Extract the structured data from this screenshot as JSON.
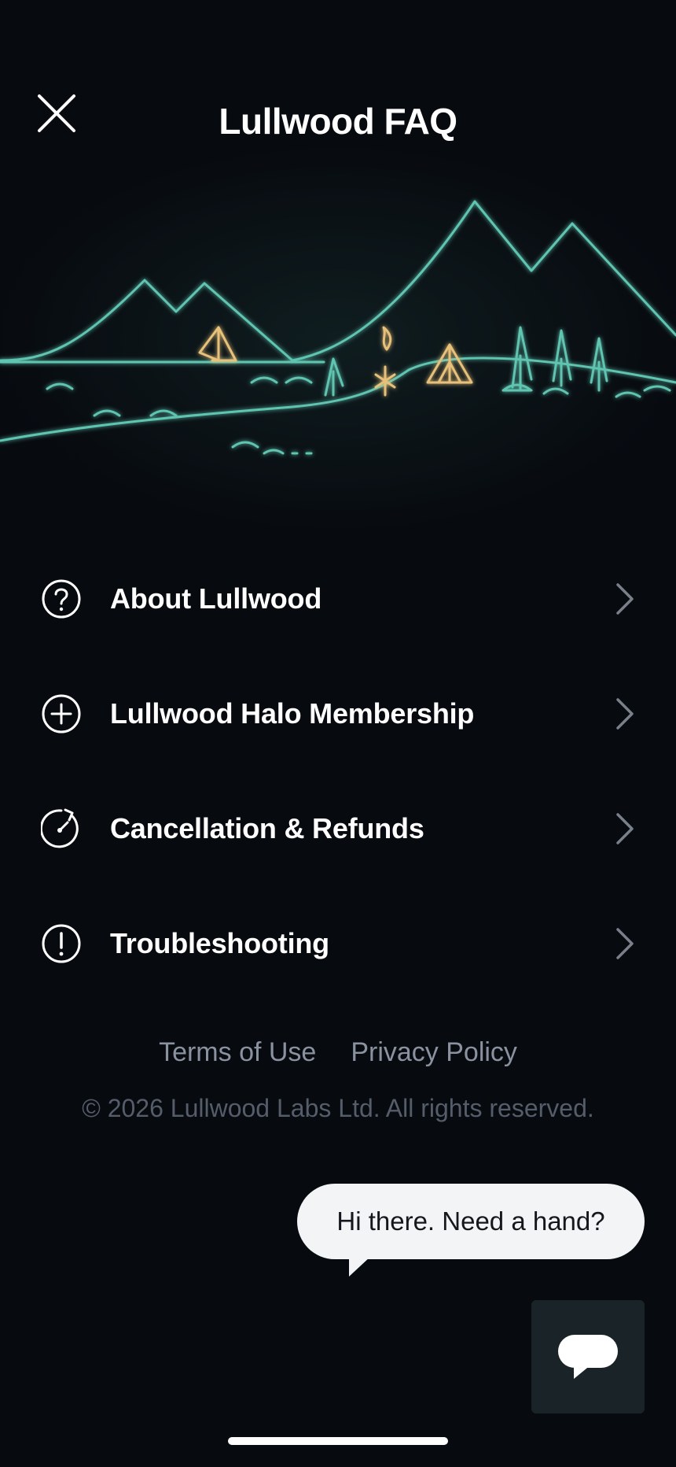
{
  "header": {
    "title": "Lullwood FAQ",
    "close_icon": "close-icon"
  },
  "faq": {
    "items": [
      {
        "label": "About Lullwood",
        "icon": "question-circle-icon"
      },
      {
        "label": "Lullwood Halo Membership",
        "icon": "plus-circle-icon"
      },
      {
        "label": "Cancellation & Refunds",
        "icon": "refresh-circle-icon"
      },
      {
        "label": "Troubleshooting",
        "icon": "exclamation-circle-icon"
      }
    ],
    "chevron_icon": "chevron-right-icon"
  },
  "footer": {
    "terms_label": "Terms of Use",
    "privacy_label": "Privacy Policy",
    "copyright": "© 2026 Lullwood Labs Ltd. All rights reserved."
  },
  "chat": {
    "bubble_text": "Hi there. Need a hand?",
    "button_icon": "chat-bubble-icon"
  },
  "colors": {
    "background": "#070a0f",
    "illustration_line": "#5ec4b0",
    "illustration_accent": "#e7c07a",
    "chevron": "#7a808a",
    "footer_link": "#8a92a0",
    "copyright": "#555d6a",
    "chat_button": "#1a2428"
  }
}
